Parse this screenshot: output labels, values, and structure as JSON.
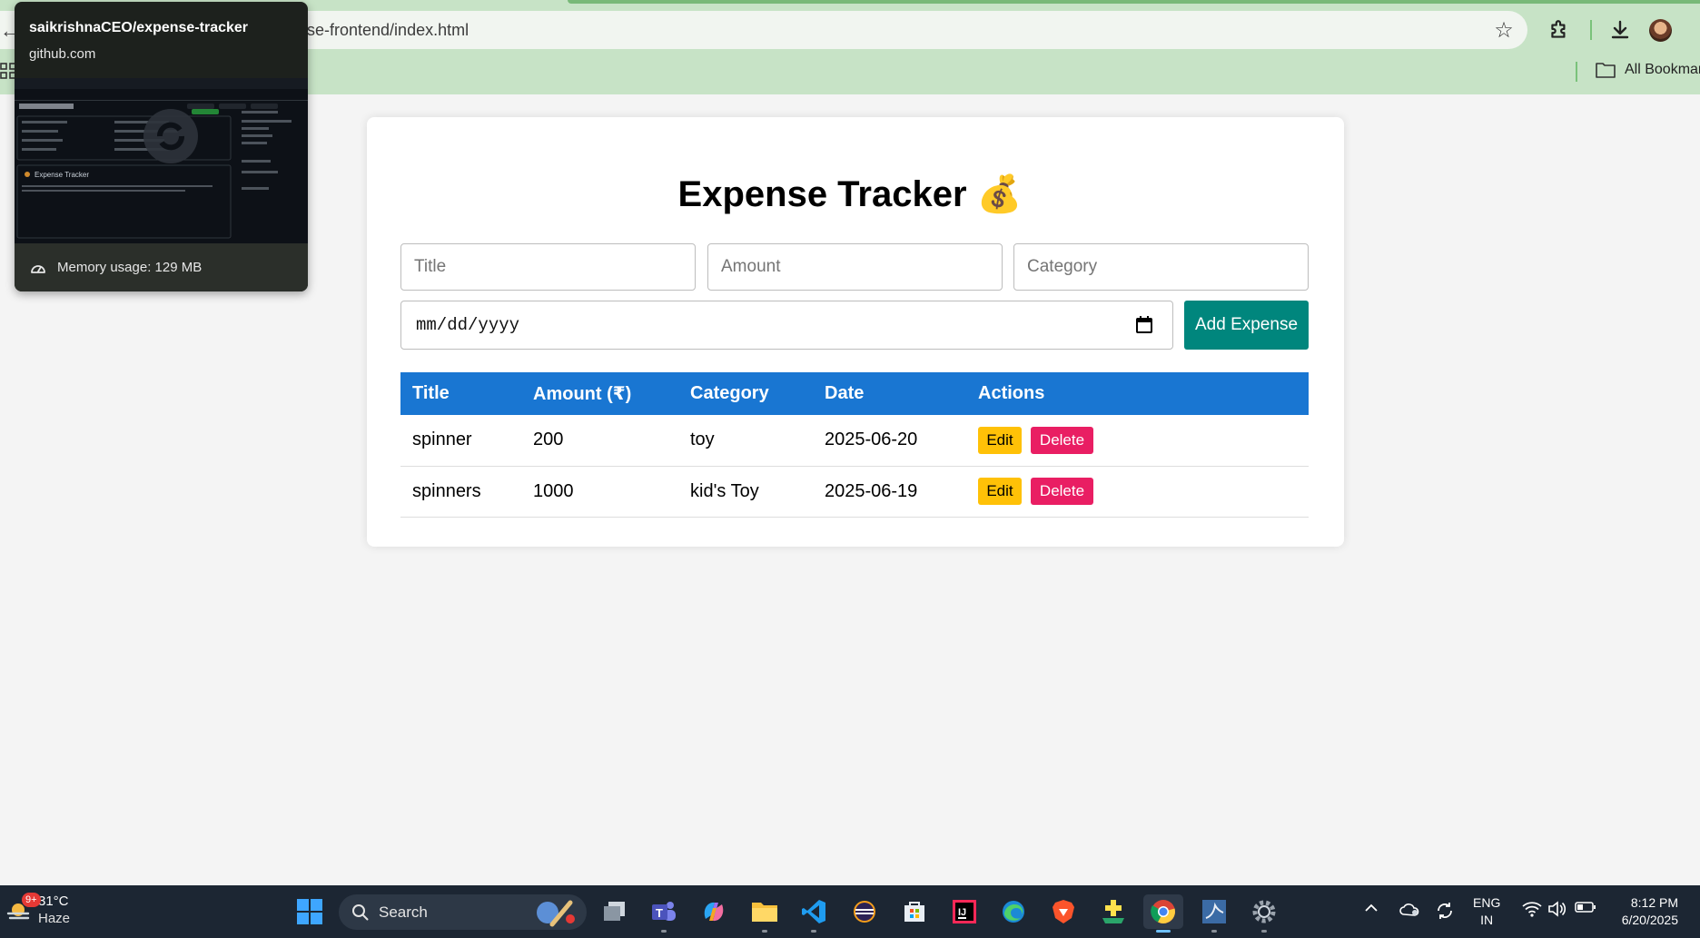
{
  "browser": {
    "url_fragment": "se-frontend/index.html",
    "bookmarks_label": "All Bookmarks"
  },
  "tab_preview": {
    "title": "saikrishnaCEO/expense-tracker",
    "domain": "github.com",
    "memory_usage": "Memory usage: 129 MB"
  },
  "page": {
    "title": "Expense Tracker",
    "title_emoji": "💰"
  },
  "form": {
    "title_placeholder": "Title",
    "amount_placeholder": "Amount",
    "category_placeholder": "Category",
    "date_placeholder": "mm/dd/yyyy",
    "add_button_label": "Add Expense"
  },
  "table": {
    "headers": [
      "Title",
      "Amount (₹)",
      "Category",
      "Date",
      "Actions"
    ],
    "rows": [
      {
        "title": "spinner",
        "amount": "200",
        "category": "toy",
        "date": "2025-06-20"
      },
      {
        "title": "spinners",
        "amount": "1000",
        "category": "kid's Toy",
        "date": "2025-06-19"
      }
    ],
    "edit_label": "Edit",
    "delete_label": "Delete"
  },
  "taskbar": {
    "weather_temp": "31°C",
    "weather_desc": "Haze",
    "weather_badge": "9+",
    "search_label": "Search",
    "lang_line1": "ENG",
    "lang_line2": "IN",
    "time": "8:12 PM",
    "date": "6/20/2025",
    "apps": [
      "task-view",
      "teams",
      "copilot",
      "file-explorer",
      "vscode",
      "eclipse",
      "microsoft-store",
      "intellij",
      "edge",
      "brave",
      "app-plus",
      "chrome",
      "mysql-workbench",
      "settings"
    ],
    "active_app": "chrome"
  },
  "colors": {
    "chrome_bg": "#c7e3c6",
    "table_header": "#1976d2",
    "add_button": "#00867d",
    "edit_button": "#ffc107",
    "delete_button": "#e91e63",
    "taskbar_bg": "#1c2633"
  }
}
